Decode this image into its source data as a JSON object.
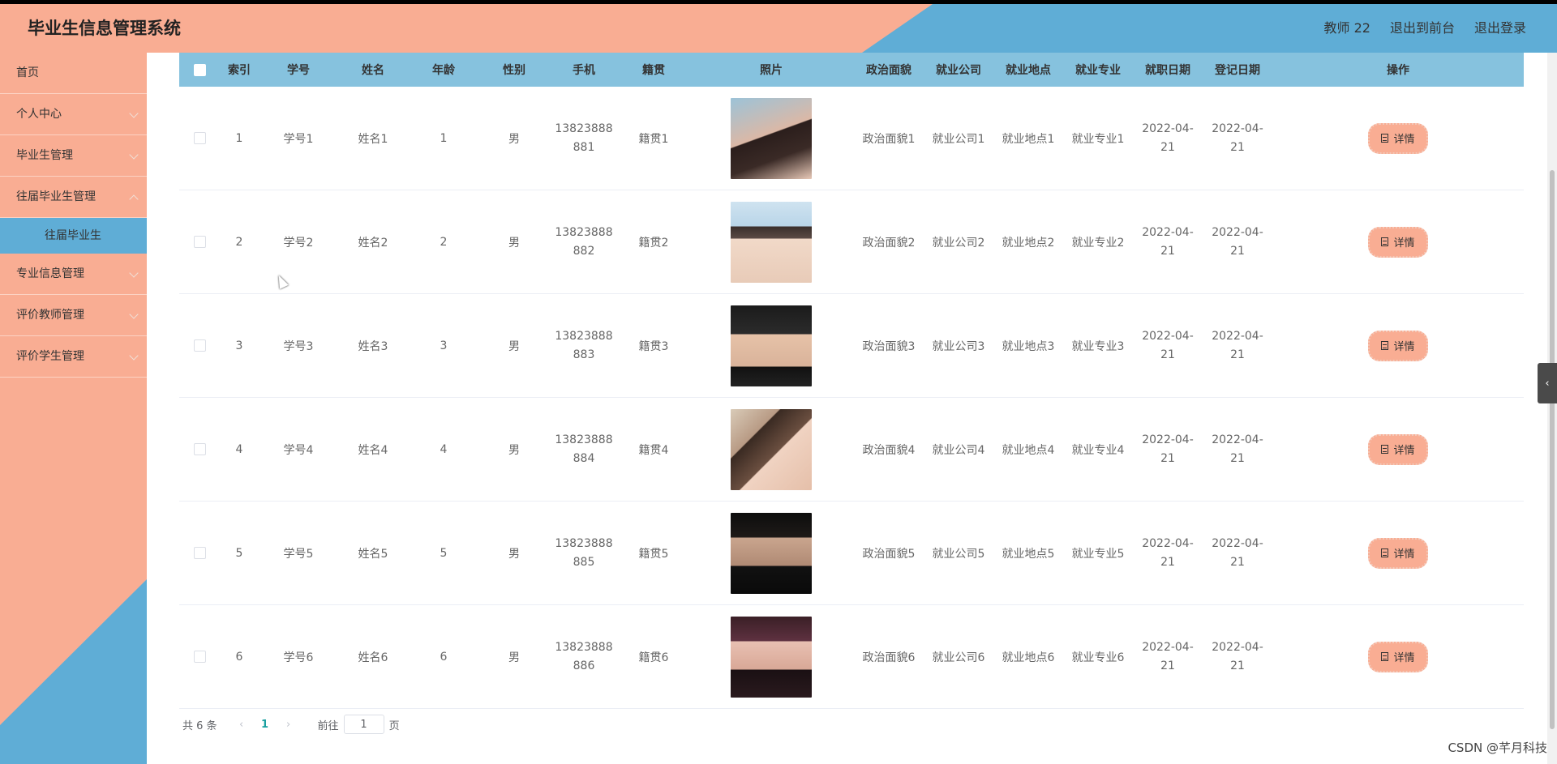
{
  "app": {
    "title": "毕业生信息管理系统",
    "user": "教师 22",
    "to_front": "退出到前台",
    "logout": "退出登录"
  },
  "sidebar": {
    "items": [
      {
        "label": "首页",
        "has_children": false
      },
      {
        "label": "个人中心",
        "has_children": true
      },
      {
        "label": "毕业生管理",
        "has_children": true
      },
      {
        "label": "往届毕业生管理",
        "has_children": true,
        "open": true,
        "children": [
          "往届毕业生"
        ]
      },
      {
        "label": "专业信息管理",
        "has_children": true
      },
      {
        "label": "评价教师管理",
        "has_children": true
      },
      {
        "label": "评价学生管理",
        "has_children": true
      }
    ],
    "active_sub": "往届毕业生"
  },
  "table": {
    "headers": [
      "索引",
      "学号",
      "姓名",
      "年龄",
      "性别",
      "手机",
      "籍贯",
      "照片",
      "政治面貌",
      "就业公司",
      "就业地点",
      "就业专业",
      "就职日期",
      "登记日期",
      "操作"
    ],
    "detail_label": "详情",
    "rows": [
      {
        "index": "1",
        "xuehao": "学号1",
        "name": "姓名1",
        "age": "1",
        "gender": "男",
        "phone1": "13823888",
        "phone2": "881",
        "jiguan": "籍贯1",
        "photo": "photo-woman-1",
        "politics": "政治面貌1",
        "company": "就业公司1",
        "place": "就业地点1",
        "major": "就业专业1",
        "job_date1": "2022-04-",
        "job_date2": "21",
        "reg_date1": "2022-04-",
        "reg_date2": "21"
      },
      {
        "index": "2",
        "xuehao": "学号2",
        "name": "姓名2",
        "age": "2",
        "gender": "男",
        "phone1": "13823888",
        "phone2": "882",
        "jiguan": "籍贯2",
        "photo": "photo-man-1",
        "politics": "政治面貌2",
        "company": "就业公司2",
        "place": "就业地点2",
        "major": "就业专业2",
        "job_date1": "2022-04-",
        "job_date2": "21",
        "reg_date1": "2022-04-",
        "reg_date2": "21"
      },
      {
        "index": "3",
        "xuehao": "学号3",
        "name": "姓名3",
        "age": "3",
        "gender": "男",
        "phone1": "13823888",
        "phone2": "883",
        "jiguan": "籍贯3",
        "photo": "photo-man-2",
        "politics": "政治面貌3",
        "company": "就业公司3",
        "place": "就业地点3",
        "major": "就业专业3",
        "job_date1": "2022-04-",
        "job_date2": "21",
        "reg_date1": "2022-04-",
        "reg_date2": "21"
      },
      {
        "index": "4",
        "xuehao": "学号4",
        "name": "姓名4",
        "age": "4",
        "gender": "男",
        "phone1": "13823888",
        "phone2": "884",
        "jiguan": "籍贯4",
        "photo": "photo-woman-2",
        "politics": "政治面貌4",
        "company": "就业公司4",
        "place": "就业地点4",
        "major": "就业专业4",
        "job_date1": "2022-04-",
        "job_date2": "21",
        "reg_date1": "2022-04-",
        "reg_date2": "21"
      },
      {
        "index": "5",
        "xuehao": "学号5",
        "name": "姓名5",
        "age": "5",
        "gender": "男",
        "phone1": "13823888",
        "phone2": "885",
        "jiguan": "籍贯5",
        "photo": "photo-man-3",
        "politics": "政治面貌5",
        "company": "就业公司5",
        "place": "就业地点5",
        "major": "就业专业5",
        "job_date1": "2022-04-",
        "job_date2": "21",
        "reg_date1": "2022-04-",
        "reg_date2": "21"
      },
      {
        "index": "6",
        "xuehao": "学号6",
        "name": "姓名6",
        "age": "6",
        "gender": "男",
        "phone1": "13823888",
        "phone2": "886",
        "jiguan": "籍贯6",
        "photo": "photo-woman-3",
        "politics": "政治面貌6",
        "company": "就业公司6",
        "place": "就业地点6",
        "major": "就业专业6",
        "job_date1": "2022-04-",
        "job_date2": "21",
        "reg_date1": "2022-04-",
        "reg_date2": "21"
      }
    ]
  },
  "pagination": {
    "total": "共 6 条",
    "current_page": "1",
    "goto_prefix": "前往",
    "goto_value": "1",
    "goto_suffix": "页"
  },
  "watermark": "CSDN @芊月科技",
  "colors": {
    "peach": "#f9ad93",
    "blue": "#5fadd6",
    "header_row": "#86c2de",
    "pager_active": "#19a0a0"
  }
}
